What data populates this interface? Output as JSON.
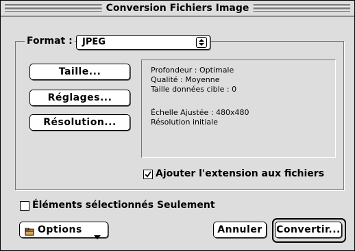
{
  "window": {
    "title": "Conversion Fichiers Image"
  },
  "format": {
    "label": "Format :",
    "selected": "JPEG"
  },
  "buttons": {
    "taille": "Taille...",
    "reglages": "Réglages...",
    "resolution": "Résolution..."
  },
  "info": {
    "depth": "Profondeur : Optimale",
    "quality": "Qualité : Moyenne",
    "target_size": "Taille données cible : 0",
    "scale": "Échelle Ajustée : 480x480",
    "resolution": "Résolution initiale"
  },
  "extension_checkbox": {
    "label": "Ajouter l'extension aux fichiers",
    "checked": true
  },
  "selected_only_checkbox": {
    "label": "Éléments sélectionnés Seulement",
    "checked": false
  },
  "options_menu": {
    "label": "Options",
    "icon": "folder-icon"
  },
  "footer": {
    "cancel_label": "Annuler",
    "convert_label": "Convertir..."
  }
}
